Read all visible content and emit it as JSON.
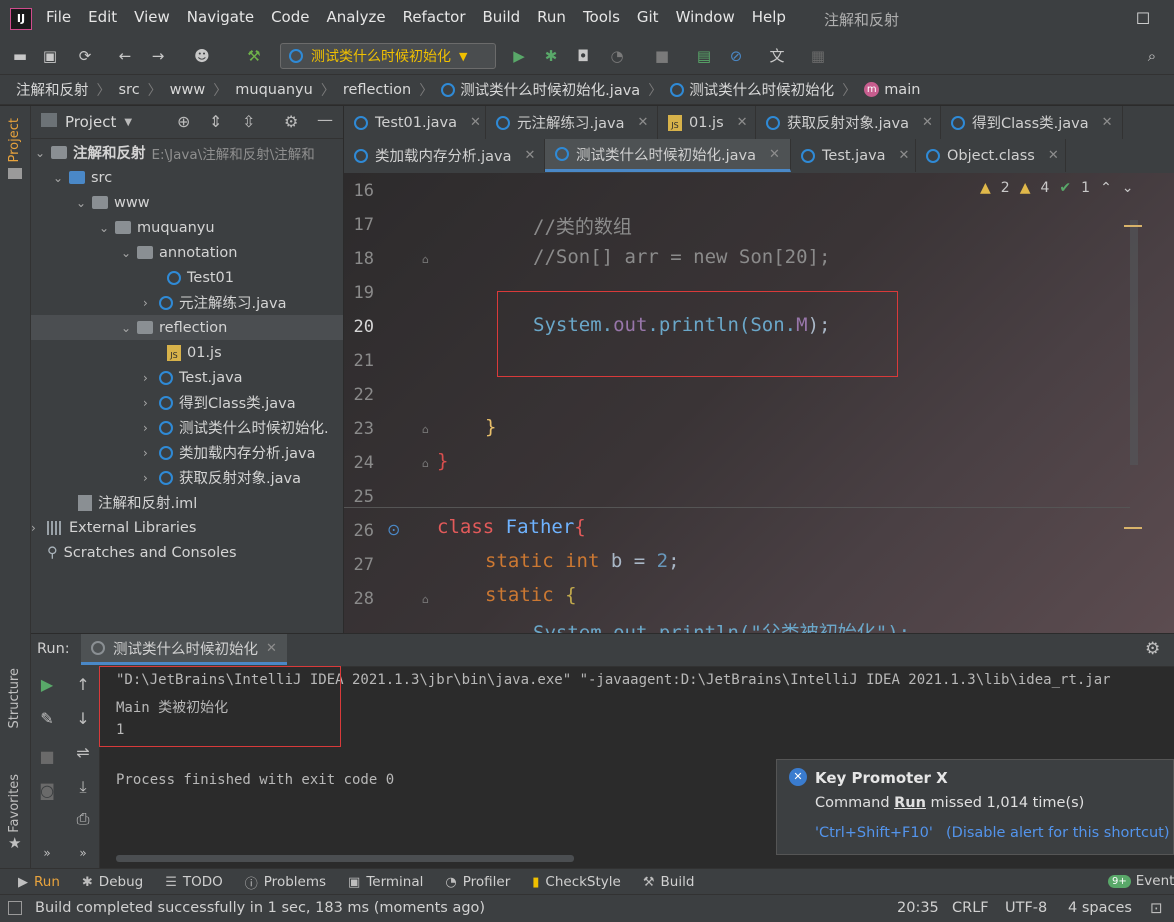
{
  "app": {
    "menu": [
      "File",
      "Edit",
      "View",
      "Navigate",
      "Code",
      "Analyze",
      "Refactor",
      "Build",
      "Run",
      "Tools",
      "Git",
      "Window",
      "Help"
    ],
    "window_title": "注解和反射",
    "logo_text": "IJ"
  },
  "toolbar": {
    "run_config": "测试类什么时候初始化"
  },
  "breadcrumb": [
    "注解和反射",
    "src",
    "www",
    "muquanyu",
    "reflection",
    "测试类什么时候初始化.java",
    "测试类什么时候初始化",
    "main"
  ],
  "project": {
    "header_label": "Project",
    "side_tab": "Project",
    "root_name": "注解和反射",
    "root_path": "E:\\Java\\注解和反射\\注解和",
    "tree": {
      "src": "src",
      "www": "www",
      "muquanyu": "muquanyu",
      "annotation": "annotation",
      "test01": "Test01",
      "meta": "元注解练习.java",
      "reflection": "reflection",
      "js01": "01.js",
      "test": "Test.java",
      "getclass": "得到Class类.java",
      "testinit": "测试类什么时候初始化.",
      "classload": "类加载内存分析.java",
      "getreflect": "获取反射对象.java",
      "iml": "注解和反射.iml",
      "libs": "External Libraries",
      "scratches": "Scratches and Consoles"
    }
  },
  "tabs": {
    "row1": [
      "Test01.java",
      "元注解练习.java",
      "01.js",
      "获取反射对象.java",
      "得到Class类.java"
    ],
    "row2": [
      "类加载内存分析.java",
      "测试类什么时候初始化.java",
      "Test.java",
      "Object.class"
    ]
  },
  "inspections": {
    "warnings1": "2",
    "warnings2": "4",
    "ok": "1"
  },
  "editor": {
    "line_numbers": [
      "16",
      "17",
      "18",
      "19",
      "20",
      "21",
      "22",
      "23",
      "24",
      "25",
      "26",
      "27",
      "28"
    ],
    "comment1": "//类的数组",
    "comment2": "//Son[] arr = new Son[20];",
    "println_obj": "System.",
    "println_out": "out",
    "println_dot": ".println(Son.",
    "println_field": "M",
    "println_end": ");",
    "brace_close": "}",
    "kw_class": "class",
    "class_name": "Father",
    "brace_open": "{",
    "kw_static": "static",
    "kw_int": "int",
    "var_b": "b = ",
    "num_2": "2",
    "semicolon": ";",
    "partial_line": "System.out.println(\"父类被初始化\");"
  },
  "run": {
    "label": "Run:",
    "tab": "测试类什么时候初始化",
    "cmd_line": "\"D:\\JetBrains\\IntelliJ IDEA 2021.1.3\\jbr\\bin\\java.exe\" \"-javaagent:D:\\JetBrains\\IntelliJ IDEA 2021.1.3\\lib\\idea_rt.jar",
    "out1": "Main 类被初始化",
    "out2": "1",
    "exit": "Process finished with exit code 0"
  },
  "promoter": {
    "title": "Key Promoter X",
    "line_prefix": "Command ",
    "command": "Run",
    "line_suffix": " missed 1,014 time(s)",
    "shortcut": "'Ctrl+Shift+F10'",
    "disable": "(Disable alert for this shortcut)"
  },
  "side_tabs": {
    "structure": "Structure",
    "favorites": "Favorites"
  },
  "bottom_tools": [
    "Run",
    "Debug",
    "TODO",
    "Problems",
    "Terminal",
    "Profiler",
    "CheckStyle",
    "Build"
  ],
  "event_log": {
    "badge": "9+",
    "label": "Event L"
  },
  "status": {
    "message": "Build completed successfully in 1 sec, 183 ms (moments ago)",
    "position": "20:35",
    "line_sep": "CRLF",
    "encoding": "UTF-8",
    "indent": "4 spaces"
  },
  "colors": {
    "accent": "#4a88c7",
    "run_config": "#f0c000",
    "highlight_box": "#d93a3a",
    "link": "#5394ec"
  }
}
